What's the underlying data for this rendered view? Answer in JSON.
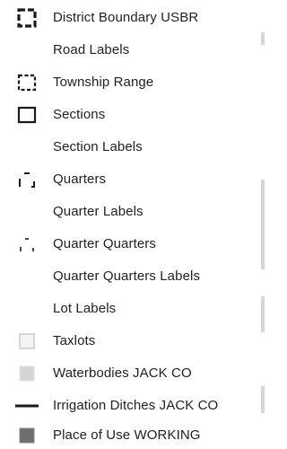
{
  "legend": {
    "items": [
      {
        "label": "District Boundary USBR",
        "symbol": "dashed-box-heavy-icon"
      },
      {
        "label": "Road Labels",
        "symbol": ""
      },
      {
        "label": "Township Range",
        "symbol": "dashed-box-icon"
      },
      {
        "label": "Sections",
        "symbol": "solid-box-icon"
      },
      {
        "label": "Section Labels",
        "symbol": ""
      },
      {
        "label": "Quarters",
        "symbol": "bracket-corners-icon"
      },
      {
        "label": "Quarter Labels",
        "symbol": ""
      },
      {
        "label": "Quarter Quarters",
        "symbol": "small-corners-icon"
      },
      {
        "label": "Quarter Quarters Labels",
        "symbol": ""
      },
      {
        "label": "Lot Labels",
        "symbol": ""
      },
      {
        "label": "Taxlots",
        "symbol": "light-box-icon"
      },
      {
        "label": "Waterbodies JACK CO",
        "symbol": "light-fill-icon"
      },
      {
        "label": "Irrigation Ditches JACK CO",
        "symbol": "line-icon"
      },
      {
        "label": "Place of Use WORKING",
        "symbol": "dark-fill-icon"
      }
    ]
  },
  "colors": {
    "text": "#222222",
    "symbol_dark": "#1a1a1a",
    "water_fill": "#d5d5d5",
    "place_of_use_fill": "#6e6e6e",
    "taxlot_stroke": "#c8c8c8"
  }
}
